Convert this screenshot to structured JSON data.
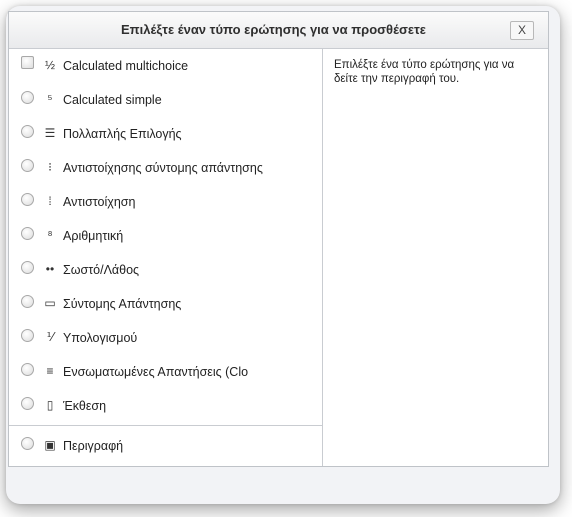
{
  "dialog": {
    "title": "Επιλέξτε έναν τύπο ερώτησης για να προσθέσετε",
    "close_label": "X"
  },
  "question_types": [
    {
      "label": "Calculated multichoice",
      "icon": "calculated-multichoice-icon",
      "glyph": "½"
    },
    {
      "label": "Calculated simple",
      "icon": "calculated-simple-icon",
      "glyph": "⁵"
    },
    {
      "label": "Πολλαπλής Επιλογής",
      "icon": "multichoice-icon",
      "glyph": "☰"
    },
    {
      "label": "Αντιστοίχησης σύντομης απάντησης",
      "icon": "random-match-icon",
      "glyph": "⁝"
    },
    {
      "label": "Αντιστοίχηση",
      "icon": "match-icon",
      "glyph": "⁞"
    },
    {
      "label": "Αριθμητική",
      "icon": "numerical-icon",
      "glyph": "⁸"
    },
    {
      "label": "Σωστό/Λάθος",
      "icon": "truefalse-icon",
      "glyph": "••"
    },
    {
      "label": "Σύντομης Απάντησης",
      "icon": "shortanswer-icon",
      "glyph": "▭"
    },
    {
      "label": "Υπολογισμού",
      "icon": "calculated-icon",
      "glyph": "⅟"
    },
    {
      "label": "Ενσωματωμένες Απαντήσεις (Clo",
      "icon": "cloze-icon",
      "glyph": "≡"
    },
    {
      "label": "Έκθεση",
      "icon": "essay-icon",
      "glyph": "▯"
    },
    {
      "label": "Περιγραφή",
      "icon": "description-icon",
      "glyph": "▣"
    }
  ],
  "description_panel": {
    "text": "Επιλέξτε ένα τύπο ερώτησης για να δείτε την περιγραφή του."
  }
}
